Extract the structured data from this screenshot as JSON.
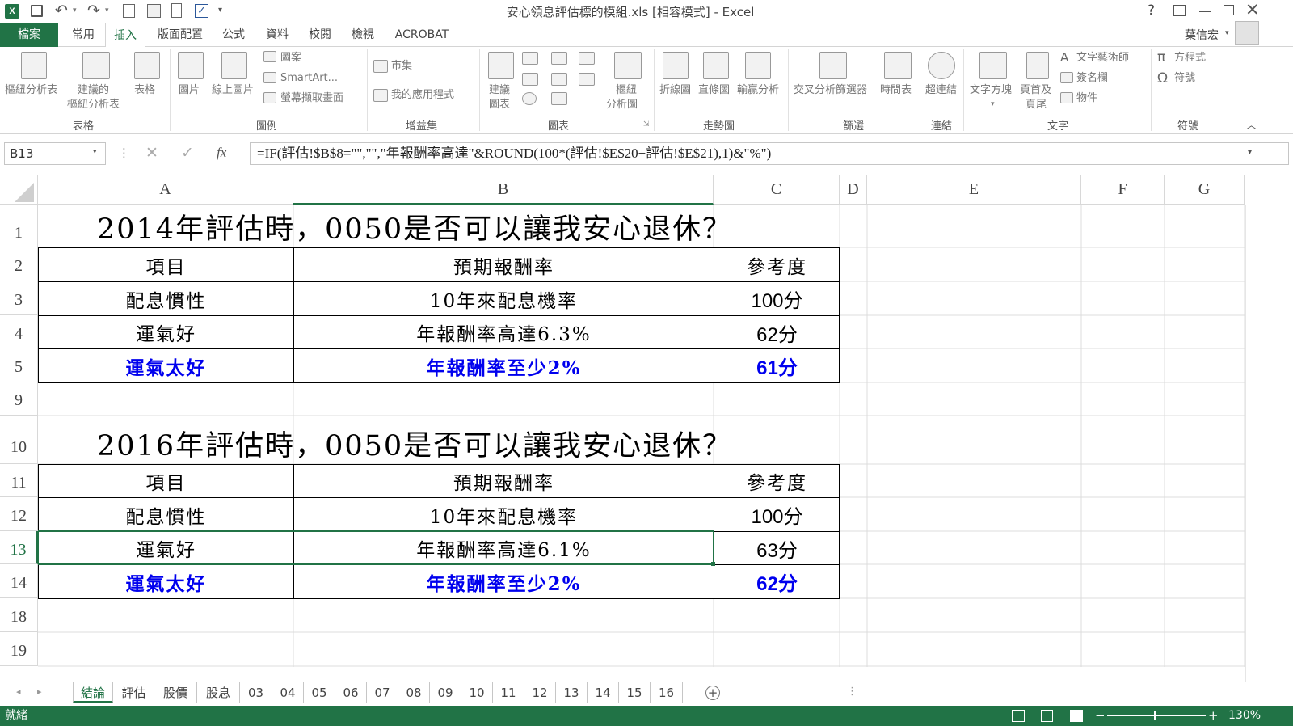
{
  "window": {
    "title": "安心領息評估標的模組.xls  [相容模式] - Excel",
    "help": "?",
    "user": "葉信宏"
  },
  "ribbon_tabs": [
    "檔案",
    "常用",
    "插入",
    "版面配置",
    "公式",
    "資料",
    "校閱",
    "檢視",
    "ACROBAT"
  ],
  "ribbon": {
    "pivot_table": "樞紐分析表",
    "recommended_pivot_1": "建議的",
    "recommended_pivot_2": "樞紐分析表",
    "table": "表格",
    "picture": "圖片",
    "online_picture": "線上圖片",
    "shapes": "圖案",
    "smartart": "SmartArt...",
    "screenshot": "螢幕擷取畫面",
    "store": "市集",
    "my_apps": "我的應用程式",
    "recommended_charts_1": "建議",
    "recommended_charts_2": "圖表",
    "pivot_chart_1": "樞紐",
    "pivot_chart_2": "分析圖",
    "line": "折線圖",
    "column": "直條圖",
    "win_loss": "輸贏分析",
    "slicer": "交叉分析篩選器",
    "timeline": "時間表",
    "hyperlink": "超連結",
    "textbox": "文字方塊",
    "header_footer_1": "頁首及",
    "header_footer_2": "頁尾",
    "wordart": "文字藝術師",
    "signature": "簽名欄",
    "object": "物件",
    "equation": "方程式",
    "symbol": "符號",
    "groups": {
      "tables": "表格",
      "illustrations": "圖例",
      "addins": "增益集",
      "charts": "圖表",
      "sparklines": "走勢圖",
      "filters": "篩選",
      "links": "連結",
      "text": "文字",
      "symbols": "符號"
    }
  },
  "formula_bar": {
    "name_box": "B13",
    "fx": "fx",
    "formula": "=IF(評估!$B$8=\"\",\"\",\"年報酬率高達\"&ROUND(100*(評估!$E$20+評估!$E$21),1)&\"%\")"
  },
  "columns": [
    "A",
    "B",
    "C",
    "D",
    "E",
    "F",
    "G"
  ],
  "rows": [
    "1",
    "2",
    "3",
    "4",
    "5",
    "9",
    "10",
    "11",
    "12",
    "13",
    "14",
    "18",
    "19"
  ],
  "table1": {
    "title": "2014年評估時，0050是否可以讓我安心退休？",
    "header": [
      "項目",
      "預期報酬率",
      "參考度"
    ],
    "r1": [
      "配息慣性",
      "10年來配息機率",
      "100分"
    ],
    "r2": [
      "運氣好",
      "年報酬率高達6.3%",
      "62分"
    ],
    "r3": [
      "運氣太好",
      "年報酬率至少2%",
      "61分"
    ]
  },
  "table2": {
    "title": "2016年評估時，0050是否可以讓我安心退休？",
    "header": [
      "項目",
      "預期報酬率",
      "參考度"
    ],
    "r1": [
      "配息慣性",
      "10年來配息機率",
      "100分"
    ],
    "r2": [
      "運氣好",
      "年報酬率高達6.1%",
      "63分"
    ],
    "r3": [
      "運氣太好",
      "年報酬率至少2%",
      "62分"
    ]
  },
  "sheet_tabs": [
    "結論",
    "評估",
    "股價",
    "股息",
    "03",
    "04",
    "05",
    "06",
    "07",
    "08",
    "09",
    "10",
    "11",
    "12",
    "13",
    "14",
    "15",
    "16"
  ],
  "status": {
    "ready": "就緒",
    "zoom": "130%"
  },
  "colors": {
    "excel_green": "#217346",
    "blue_text": "#0000ee",
    "selection": "#217346"
  }
}
